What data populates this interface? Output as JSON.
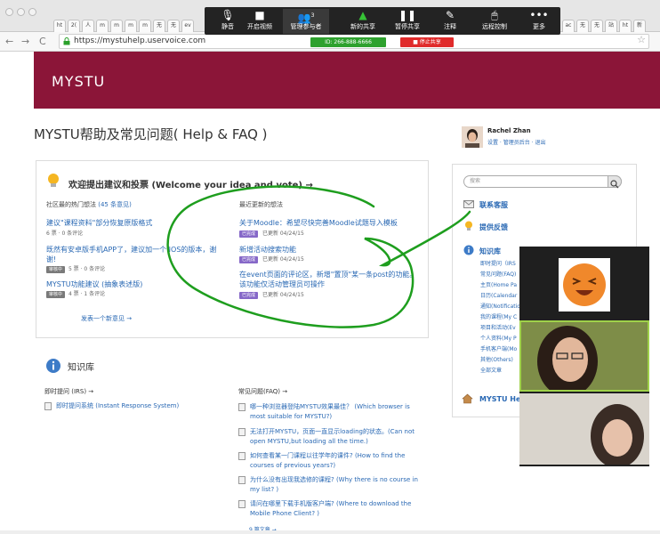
{
  "browser": {
    "tabs": [
      "ht",
      "2(",
      "人",
      "m",
      "m",
      "m",
      "m",
      "无",
      "无",
      "ev",
      "ac",
      "无",
      "无",
      "站",
      "ht",
      "新"
    ],
    "url": "https://mystuhelp.uservoice.com"
  },
  "zoom": {
    "buttons": [
      {
        "label": "静音"
      },
      {
        "label": "开启视频"
      },
      {
        "label": "管理参与者",
        "count": "3"
      },
      {
        "label": "新的共享"
      },
      {
        "label": "暂停共享"
      },
      {
        "label": "注释"
      },
      {
        "label": "远程控制"
      },
      {
        "label": "更多"
      }
    ],
    "meeting_id": "ID: 266-888-6666",
    "stop_share": "■ 停止共享"
  },
  "site": {
    "logo": "MYSTU",
    "page_title": "MYSTU帮助及常见问题( Help & FAQ )",
    "user": {
      "name": "Rachel Zhan",
      "links": "设置 · 管理员后台 · 退出"
    }
  },
  "ideas": {
    "title": "欢迎提出建议和投票 (Welcome your idea and vote) →",
    "left_head": "社区最的热门想法",
    "left_count": "(45 条意见)",
    "right_head": "最近更新的想法",
    "left_items": [
      {
        "title": "建议\"课程资料\"部分恢复原版格式",
        "meta": "6 票 · 0 条评论",
        "badge": ""
      },
      {
        "title": "既然有安卓版手机APP了，建议加一个 IOS的版本，谢谢!",
        "meta": "5 票 · 0 条评论",
        "badge": "审核中"
      },
      {
        "title": "MYSTU功能建议 (抽象表述版)",
        "meta": "4 票 · 1 条评论",
        "badge": "审核中"
      }
    ],
    "right_items": [
      {
        "title": "关于Moodle：希望尽快完善Moodle试题导入模板",
        "badge": "已完成",
        "meta": "已更新 04/24/15"
      },
      {
        "title": "新增活动搜索功能",
        "badge": "已完成",
        "meta": "已更新 04/24/15"
      },
      {
        "title": "在event页面的评论区，新增\"置顶\"某一条post的功能。该功能仅活动管理员可操作",
        "badge": "已完成",
        "meta": "已更新 04/24/15"
      }
    ],
    "post_link": "发表一个新意见 →"
  },
  "kb": {
    "title": "知识库",
    "left_head": "即时提问 (IRS) →",
    "left_items": [
      "即时提问系统 (Instant Response System)"
    ],
    "right_head": "常见问题(FAQ) →",
    "right_items": [
      "哪一种浏览器登陆MYSTU效果最佳？ (Which browser is most suitable for MYSTU?)",
      "无法打开MYSTU，页面一直显示loading的状态。(Can not open MYSTU,but loading all the time.)",
      "如何查看某一门课程以往学年的课件? (How to find the courses of previous years?)",
      "为什么没有出现我选修的课程? (Why there is no course in my list? )",
      "请问在哪里下载手机版客户端? (Where to download the Mobile Phone Client? )"
    ],
    "more": "9 篇文章 →"
  },
  "sidebar": {
    "search_placeholder": "搜索",
    "contact": "联系客服",
    "feedback": "提供反馈",
    "kb_head": "知识库",
    "kb_items": [
      "即时提问（IRS",
      "常见问题(FAQ)",
      "主页(Home Pa",
      "日历(Calendar",
      "通知(Notificatio",
      "我的课程(My C",
      "项目和活动(Ev",
      "个人资料(My P",
      "手机客户端(Mo",
      "其他(Others)",
      "全部文章"
    ],
    "bottom": "MYSTU Help"
  },
  "colors": {
    "brand": "#8b1538",
    "link": "#2a69b4",
    "annotation": "#1e9e1e"
  }
}
